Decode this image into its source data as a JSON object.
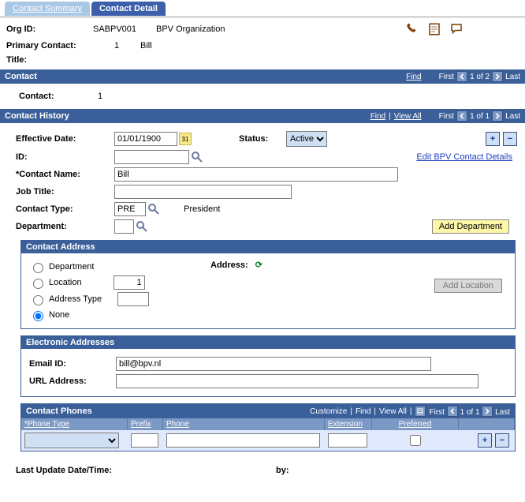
{
  "tabs": {
    "summary": "Contact Summary",
    "detail": "Contact Detail"
  },
  "header": {
    "org_id_label": "Org ID:",
    "org_id_value": "SABPV001",
    "org_name": "BPV Organization",
    "primary_contact_label": "Primary Contact:",
    "primary_contact_num": "1",
    "primary_contact_name": "Bill",
    "title_label": "Title:"
  },
  "contact_bar": {
    "title": "Contact",
    "find": "Find",
    "first": "First",
    "counter": "1 of 2",
    "last": "Last",
    "contact_label": "Contact:",
    "contact_value": "1"
  },
  "history_bar": {
    "title": "Contact History",
    "find": "Find",
    "view_all": "View All",
    "first": "First",
    "counter": "1 of 1",
    "last": "Last"
  },
  "form": {
    "eff_date_label": "Effective Date:",
    "eff_date_value": "01/01/1900",
    "status_label": "Status:",
    "status_value": "Active",
    "id_label": "ID:",
    "id_value": "",
    "edit_link": "Edit BPV Contact Details",
    "name_label": "*Contact Name:",
    "name_value": "Bill",
    "job_label": "Job Title:",
    "job_value": "",
    "ctype_label": "Contact Type:",
    "ctype_value": "PRE",
    "ctype_desc": "President",
    "dept_label": "Department:",
    "dept_value": "",
    "add_dept": "Add Department"
  },
  "address_box": {
    "title": "Contact Address",
    "address_label": "Address:",
    "opt_dept": "Department",
    "opt_loc": "Location",
    "loc_value": "1",
    "opt_addr": "Address Type",
    "addr_value": "",
    "opt_none": "None",
    "add_location": "Add Location"
  },
  "elec_box": {
    "title": "Electronic Addresses",
    "email_label": "Email ID:",
    "email_value": "bill@bpv.nl",
    "url_label": "URL Address:",
    "url_value": ""
  },
  "phones": {
    "title": "Contact Phones",
    "customize": "Customize",
    "find": "Find",
    "view_all": "View All",
    "first": "First",
    "counter": "1 of 1",
    "last": "Last",
    "col_type": "*Phone Type",
    "col_prefix": "Prefix",
    "col_phone": "Phone",
    "col_ext": "Extension",
    "col_pref": "Preferred"
  },
  "footer": {
    "last_update_label": "Last Update Date/Time:",
    "by_label": "by:"
  }
}
